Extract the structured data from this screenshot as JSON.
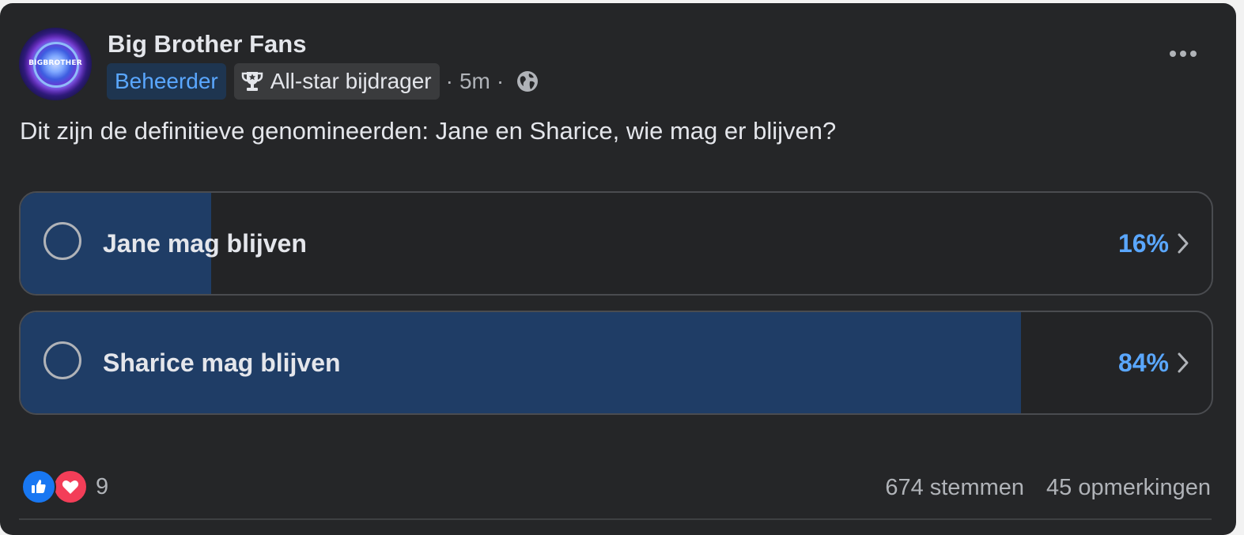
{
  "post": {
    "page_name": "Big Brother Fans",
    "avatar_logo_text": "BIGBROTHER",
    "badge_admin": "Beheerder",
    "badge_star": "All-star bijdrager",
    "time_separator": "·",
    "time": "5m",
    "visibility_icon": "globe-icon",
    "text": "Dit zijn de definitieve genomineerden: Jane en Sharice, wie mag er blijven?"
  },
  "poll": {
    "options": [
      {
        "label": "Jane mag blijven",
        "percent_text": "16%",
        "percent": 16
      },
      {
        "label": "Sharice mag blijven",
        "percent_text": "84%",
        "percent": 84
      }
    ]
  },
  "footer": {
    "reaction_icons": [
      "like-icon",
      "love-icon"
    ],
    "reaction_count": "9",
    "votes": "674 stemmen",
    "comments": "45 opmerkingen"
  },
  "colors": {
    "card_background": "#252628",
    "accent_blue": "#5aa7ff",
    "poll_fill": "#1f3d66",
    "secondary_text": "#b0b3b8"
  }
}
